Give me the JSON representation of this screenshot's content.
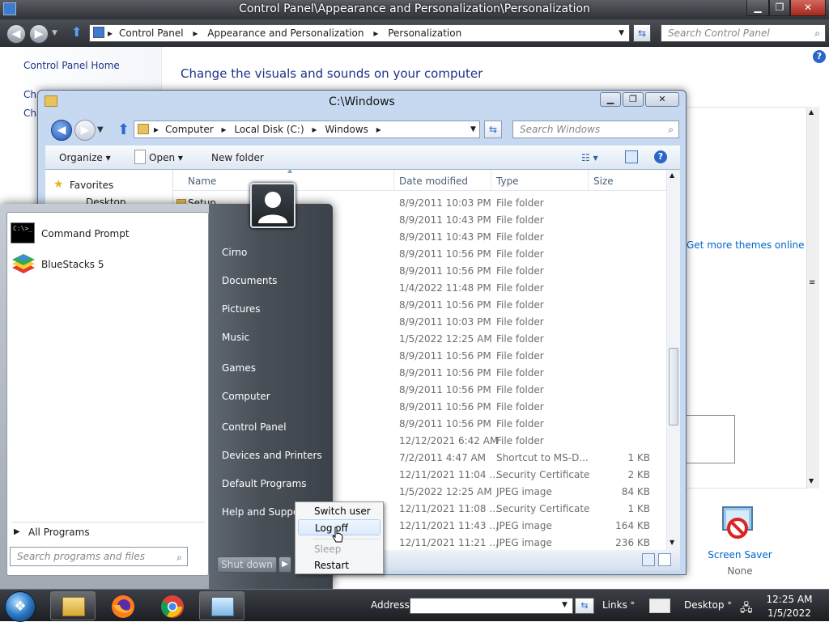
{
  "control_panel": {
    "title": "Control Panel\\Appearance and Personalization\\Personalization",
    "breadcrumb": [
      "Control Panel",
      "Appearance and Personalization",
      "Personalization"
    ],
    "search_placeholder": "Search Control Panel",
    "left_pane": {
      "home_link": "Control Panel Home",
      "link_1_partial": "Cha",
      "link_2_partial": "Cha"
    },
    "heading": "Change the visuals and sounds on your computer",
    "themes_link": "Get more themes online",
    "screen_saver": {
      "label": "Screen Saver",
      "value": "None"
    },
    "help_icon": "?"
  },
  "explorer": {
    "title": "C:\\Windows",
    "breadcrumb": [
      "Computer",
      "Local Disk (C:)",
      "Windows"
    ],
    "search_placeholder": "Search Windows",
    "toolbar": {
      "organize": "Organize",
      "open": "Open",
      "new_folder": "New folder"
    },
    "nav": {
      "favorites": "Favorites",
      "desktop": "Desktop"
    },
    "columns": {
      "name": "Name",
      "date": "Date modified",
      "type": "Type",
      "size": "Size"
    },
    "rows": [
      {
        "name": "Setup",
        "date": "8/9/2011 10:03 PM",
        "type": "File folder",
        "size": ""
      },
      {
        "name": "",
        "date": "8/9/2011 10:43 PM",
        "type": "File folder",
        "size": ""
      },
      {
        "name": "",
        "date": "8/9/2011 10:43 PM",
        "type": "File folder",
        "size": ""
      },
      {
        "name": "",
        "date": "8/9/2011 10:56 PM",
        "type": "File folder",
        "size": ""
      },
      {
        "name": "",
        "date": "8/9/2011 10:56 PM",
        "type": "File folder",
        "size": ""
      },
      {
        "name": "",
        "date": "1/4/2022 11:48 PM",
        "type": "File folder",
        "size": ""
      },
      {
        "name": "",
        "date": "8/9/2011 10:56 PM",
        "type": "File folder",
        "size": ""
      },
      {
        "name": "",
        "date": "8/9/2011 10:03 PM",
        "type": "File folder",
        "size": ""
      },
      {
        "name": "",
        "date": "1/5/2022 12:25 AM",
        "type": "File folder",
        "size": ""
      },
      {
        "name": "",
        "date": "8/9/2011 10:56 PM",
        "type": "File folder",
        "size": ""
      },
      {
        "name": "",
        "date": "8/9/2011 10:56 PM",
        "type": "File folder",
        "size": ""
      },
      {
        "name": "",
        "date": "8/9/2011 10:56 PM",
        "type": "File folder",
        "size": ""
      },
      {
        "name": "",
        "date": "8/9/2011 10:56 PM",
        "type": "File folder",
        "size": ""
      },
      {
        "name": "",
        "date": "8/9/2011 10:56 PM",
        "type": "File folder",
        "size": ""
      },
      {
        "name": "",
        "date": "12/12/2021 6:42 AM",
        "type": "File folder",
        "size": ""
      },
      {
        "name": "",
        "date": "7/2/2011 4:47 AM",
        "type": "Shortcut to MS-D...",
        "size": "1 KB"
      },
      {
        "name": "",
        "date": "12/11/2021 11:04 ...",
        "type": "Security Certificate",
        "size": "2 KB"
      },
      {
        "name": "",
        "date": "1/5/2022 12:25 AM",
        "type": "JPEG image",
        "size": "84 KB"
      },
      {
        "name": "",
        "date": "12/11/2021 11:08 ...",
        "type": "Security Certificate",
        "size": "1 KB"
      },
      {
        "name": "",
        "date": "12/11/2021 11:43 ...",
        "type": "JPEG image",
        "size": "164 KB"
      },
      {
        "name": "",
        "date": "12/11/2021 11:21 ...",
        "type": "JPEG image",
        "size": "236 KB"
      }
    ]
  },
  "start_menu": {
    "programs": [
      "Command Prompt",
      "BlueStacks 5"
    ],
    "cmd_icon_text": "C:\\>_",
    "all_programs": "All Programs",
    "search_placeholder": "Search programs and files",
    "right_links": [
      "Cirno",
      "Documents",
      "Pictures",
      "Music",
      "Games",
      "Computer",
      "Control Panel",
      "Devices and Printers",
      "Default Programs",
      "Help and Support"
    ],
    "shutdown_label": "Shut down",
    "power_menu": [
      "Switch user",
      "Log off",
      "Sleep",
      "Restart"
    ]
  },
  "taskbar": {
    "address_label": "Address",
    "links_label": "Links",
    "desktop_label": "Desktop",
    "time": "12:25 AM",
    "date": "1/5/2022"
  }
}
